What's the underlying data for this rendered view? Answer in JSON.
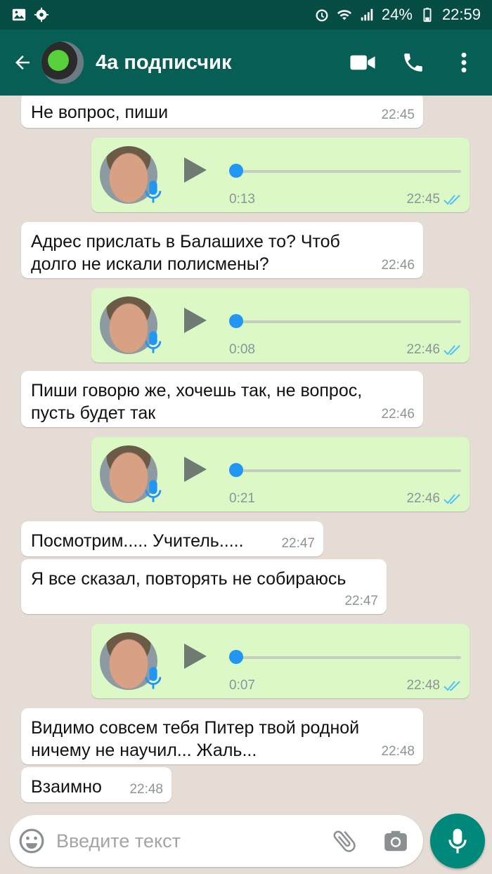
{
  "status_bar": {
    "battery": "24%",
    "clock": "22:59",
    "icons": [
      "gallery-icon",
      "settings-gear-icon",
      "alarm-icon",
      "wifi-icon",
      "signal-icon",
      "battery-icon"
    ]
  },
  "header": {
    "contact_name": "4а подписчик",
    "icons": [
      "back-arrow-icon",
      "video-call-icon",
      "phone-call-icon",
      "more-vertical-icon"
    ]
  },
  "messages": [
    {
      "kind": "text",
      "direction": "in",
      "lines": [
        "Не вопрос, пиши"
      ],
      "time": "22:45"
    },
    {
      "kind": "voice",
      "direction": "out",
      "duration": "0:13",
      "time": "22:45",
      "progress": 0
    },
    {
      "kind": "text",
      "direction": "in",
      "lines": [
        "Адрес прислать в Балашихе то? Чтоб",
        "долго не искали полисмены?"
      ],
      "time": "22:46"
    },
    {
      "kind": "voice",
      "direction": "out",
      "duration": "0:08",
      "time": "22:46",
      "progress": 0
    },
    {
      "kind": "text",
      "direction": "in",
      "lines": [
        "Пиши говорю же, хочешь так, не вопрос,",
        "пусть будет так"
      ],
      "time": "22:46"
    },
    {
      "kind": "voice",
      "direction": "out",
      "duration": "0:21",
      "time": "22:46",
      "progress": 0
    },
    {
      "kind": "text",
      "direction": "in",
      "lines": [
        "Посмотрим..... Учитель....."
      ],
      "time": "22:47"
    },
    {
      "kind": "text",
      "direction": "in",
      "lines": [
        "Я все сказал, повторять не собираюсь"
      ],
      "time": "22:47"
    },
    {
      "kind": "voice",
      "direction": "out",
      "duration": "0:07",
      "time": "22:48",
      "progress": 0
    },
    {
      "kind": "text",
      "direction": "in",
      "lines": [
        "Видимо совсем тебя Питер твой родной",
        "ничему не научил... Жаль..."
      ],
      "time": "22:48"
    },
    {
      "kind": "text",
      "direction": "in",
      "lines": [
        "Взаимно"
      ],
      "time": "22:48"
    }
  ],
  "composer": {
    "placeholder": "Введите текст",
    "icons": [
      "emoji-icon",
      "attach-paperclip-icon",
      "camera-icon",
      "microphone-icon"
    ]
  },
  "colors": {
    "header": "#075e54",
    "status_bar": "#054d44",
    "outgoing_bubble": "#dcf8c6",
    "incoming_bubble": "#ffffff",
    "read_ticks": "#4fc3f7",
    "voice_progress": "#2196f3",
    "mic_fab": "#00897b"
  }
}
